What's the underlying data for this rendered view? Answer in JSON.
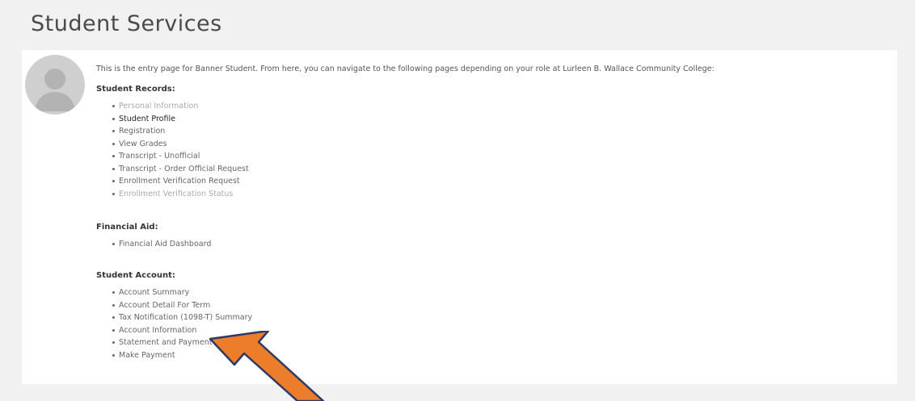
{
  "page": {
    "title": "Student Services",
    "intro": "This is the entry page for Banner Student. From here, you can navigate to the following pages depending on your role at Lurleen B. Wallace Community College:"
  },
  "sections": {
    "records": {
      "title": "Student Records:",
      "items": [
        "Personal Information",
        "Student Profile",
        "Registration",
        "View Grades",
        "Transcript - Unofficial",
        "Transcript - Order Official Request",
        "Enrollment Verification Request",
        "Enrollment Verification Status"
      ]
    },
    "aid": {
      "title": "Financial Aid:",
      "items": [
        "Financial Aid Dashboard"
      ]
    },
    "account": {
      "title": "Student Account:",
      "items": [
        "Account Summary",
        "Account Detail For Term",
        "Tax Notification (1098-T) Summary",
        "Account Information",
        "Statement and Payment History",
        "Make Payment"
      ]
    }
  },
  "colors": {
    "arrow": "#ec7d2b",
    "arrow_outline": "#2c3a66"
  },
  "icons": {
    "avatar": "user-silhouette-icon",
    "pointer": "arrow-pointer-icon"
  }
}
